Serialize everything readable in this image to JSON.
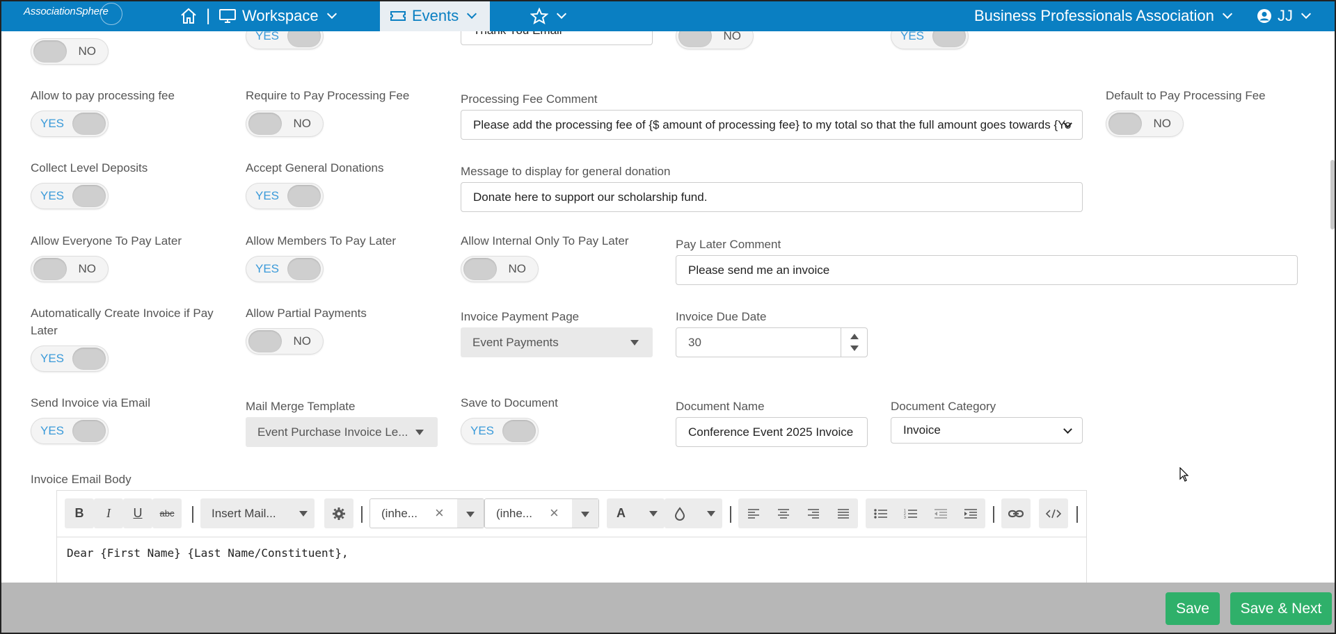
{
  "nav": {
    "logo": "AssociationSphere",
    "separator": "|",
    "workspace": "Workspace",
    "events": "Events",
    "org": "Business Professionals Association",
    "user": "JJ"
  },
  "top_row": {
    "toggle1": "NO",
    "toggle2": "YES",
    "select": "Thank You Email",
    "toggle4": "NO",
    "toggle5": "YES"
  },
  "row1": {
    "allow_fee_label": "Allow to pay processing fee",
    "allow_fee_val": "YES",
    "require_fee_label": "Require to Pay Processing Fee",
    "require_fee_val": "NO",
    "fee_comment_label": "Processing Fee Comment",
    "fee_comment_val": "Please add the processing fee of {$ amount of processing fee} to my total so that the full amount goes towards {Yo",
    "default_fee_label": "Default to Pay Processing Fee",
    "default_fee_val": "NO"
  },
  "row2": {
    "deposits_label": "Collect Level Deposits",
    "deposits_val": "YES",
    "donations_label": "Accept General Donations",
    "donations_val": "YES",
    "donation_msg_label": "Message to display for general donation",
    "donation_msg_val": "Donate here to support our scholarship fund."
  },
  "row3": {
    "everyone_label": "Allow Everyone To Pay Later",
    "everyone_val": "NO",
    "members_label": "Allow Members To Pay Later",
    "members_val": "YES",
    "internal_label": "Allow Internal Only To Pay Later",
    "internal_val": "NO",
    "comment_label": "Pay Later Comment",
    "comment_val": "Please send me an invoice"
  },
  "row4": {
    "auto_invoice_label_1": "Automatically Create Invoice if Pay",
    "auto_invoice_label_2": "Later",
    "auto_invoice_val": "YES",
    "partial_label": "Allow Partial Payments",
    "partial_val": "NO",
    "payment_page_label": "Invoice Payment Page",
    "payment_page_val": "Event Payments",
    "due_date_label": "Invoice Due Date",
    "due_date_val": "30"
  },
  "row5": {
    "send_email_label": "Send Invoice via Email",
    "send_email_val": "YES",
    "template_label": "Mail Merge Template",
    "template_val": "Event Purchase Invoice Le...",
    "save_doc_label": "Save to Document",
    "save_doc_val": "YES",
    "doc_name_label": "Document Name",
    "doc_name_val": "Conference Event 2025 Invoice",
    "doc_cat_label": "Document Category",
    "doc_cat_val": "Invoice"
  },
  "editor": {
    "label": "Invoice Email Body",
    "insert_mail": "Insert Mail...",
    "font1": "(inhe...",
    "font2": "(inhe...",
    "body": "Dear {First Name} {Last Name/Constituent},"
  },
  "footer": {
    "save": "Save",
    "save_next": "Save & Next"
  }
}
